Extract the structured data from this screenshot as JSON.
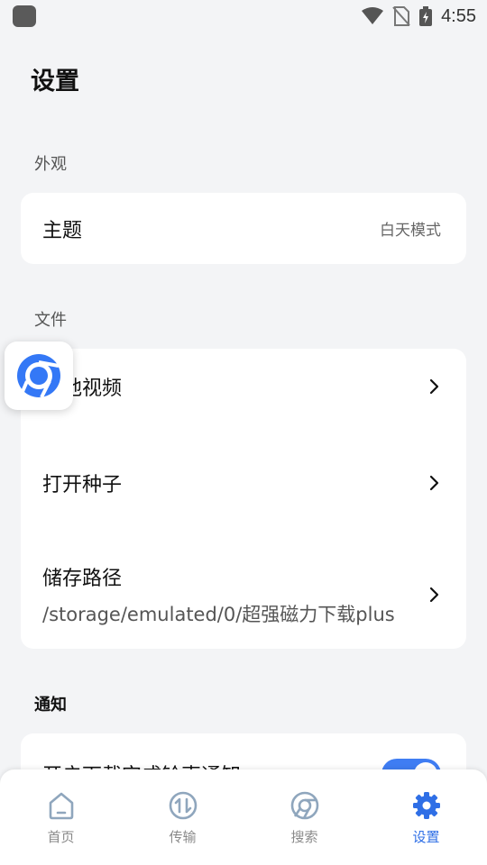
{
  "status_bar": {
    "time": "4:55"
  },
  "page": {
    "title": "设置"
  },
  "sections": {
    "appearance": {
      "label": "外观",
      "theme_label": "主题",
      "theme_value": "白天模式"
    },
    "files": {
      "label": "文件",
      "local_video_label": "本地视频",
      "open_torrent_label": "打开种子",
      "storage_path_label": "储存路径",
      "storage_path_value": "/storage/emulated/0/超强磁力下载plus"
    },
    "notifications": {
      "label": "通知",
      "download_complete_label": "开启下载完成铃声通知",
      "download_complete_enabled": true
    }
  },
  "bottom_nav": {
    "items": [
      {
        "label": "首页",
        "icon": "home-icon",
        "active": false
      },
      {
        "label": "传输",
        "icon": "transfer-icon",
        "active": false
      },
      {
        "label": "搜索",
        "icon": "browser-icon",
        "active": false
      },
      {
        "label": "设置",
        "icon": "gear-icon",
        "active": true
      }
    ]
  },
  "colors": {
    "accent": "#3f7df3",
    "background": "#f3f4f6",
    "card": "#ffffff"
  }
}
